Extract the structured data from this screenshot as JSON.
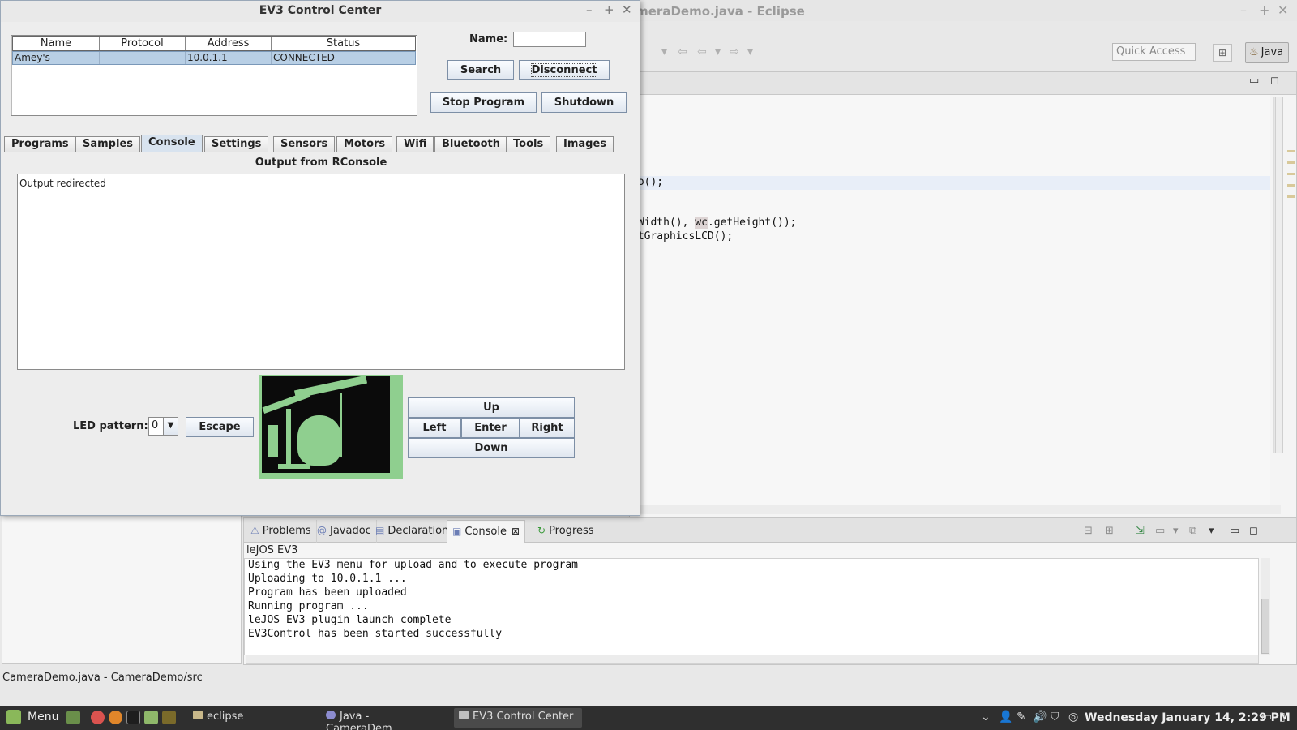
{
  "eclipse": {
    "title_fragment": "ameraDemo.java - Eclipse",
    "quick_access_placeholder": "Quick Access",
    "perspective_label": "Java",
    "code_lines": [
      "eo();",
      "tWidth(), ",
      "wc",
      ".getHeight());",
      "etGraphicsLCD();"
    ],
    "console_tabs": [
      {
        "label": "Problems",
        "icon": "problems-icon"
      },
      {
        "label": "Javadoc",
        "icon": "at-icon"
      },
      {
        "label": "Declaration",
        "icon": "declaration-icon"
      },
      {
        "label": "Console",
        "icon": "console-icon"
      },
      {
        "label": "Progress",
        "icon": "progress-icon"
      }
    ],
    "console_label": "leJOS EV3",
    "console_lines": [
      "Using the EV3 menu for upload and to execute program",
      "Uploading to 10.0.1.1 ...",
      "Program has been uploaded",
      "Running program ...",
      "leJOS EV3 plugin launch complete",
      "EV3Control has been started successfully"
    ],
    "status_text": "CameraDemo.java - CameraDemo/src"
  },
  "ev3": {
    "title": "EV3 Control Center",
    "table": {
      "columns": [
        "Name",
        "Protocol",
        "Address",
        "Status"
      ],
      "rows": [
        {
          "name": "Amey's",
          "protocol": "",
          "address": "10.0.1.1",
          "status": "CONNECTED"
        }
      ]
    },
    "name_label": "Name:",
    "name_value": "",
    "buttons": {
      "search": "Search",
      "disconnect": "Disconnect",
      "stop_program": "Stop Program",
      "shutdown": "Shutdown",
      "escape": "Escape",
      "up": "Up",
      "left": "Left",
      "enter": "Enter",
      "right": "Right",
      "down": "Down"
    },
    "tabs": [
      "Programs",
      "Samples",
      "Console",
      "Settings",
      "Sensors",
      "Motors",
      "Wifi",
      "Bluetooth",
      "Tools",
      "Images"
    ],
    "active_tab": "Console",
    "console_title": "Output from RConsole",
    "console_text": "Output redirected",
    "led_label": "LED pattern:",
    "led_value": "0"
  },
  "taskbar": {
    "menu_label": "Menu",
    "windows": [
      "eclipse",
      "Java - CameraDem...",
      "EV3 Control Center"
    ],
    "active_window": "EV3 Control Center",
    "clock": "Wednesday January 14,  2:29 PM"
  },
  "colors": {
    "taskbar_bg": "#2f2f2f",
    "selection_row": "#b8cfe5",
    "lcd_green": "#8fcf8f"
  }
}
